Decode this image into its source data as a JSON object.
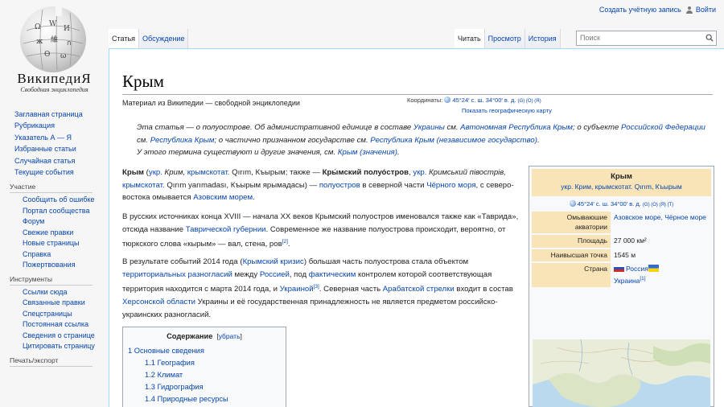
{
  "logo": {
    "title": "ВикипедиЯ",
    "subtitle": "Свободная энциклопедия"
  },
  "personal": {
    "create_account": "Создать учётную запись",
    "login": "Войти"
  },
  "tabs": {
    "left": [
      "Статья",
      "Обсуждение"
    ],
    "right": [
      "Читать",
      "Просмотр",
      "История"
    ]
  },
  "search": {
    "placeholder": "Поиск"
  },
  "sidebar": {
    "main": [
      "Заглавная страница",
      "Рубрикация",
      "Указатель А — Я",
      "Избранные статьи",
      "Случайная статья",
      "Текущие события"
    ],
    "participation": {
      "heading": "Участие",
      "items": [
        "Сообщить об ошибке",
        "Портал сообщества",
        "Форум",
        "Свежие правки",
        "Новые страницы",
        "Справка",
        "Пожертвования"
      ]
    },
    "tools": {
      "heading": "Инструменты",
      "items": [
        "Ссылки сюда",
        "Связанные правки",
        "Спецстраницы",
        "Постоянная ссылка",
        "Сведения о странице",
        "Цитировать страницу"
      ]
    },
    "print": {
      "heading": "Печать/экспорт"
    }
  },
  "article": {
    "title": "Крым",
    "tagline": "Материал из Википедии — свободной энциклопедии",
    "coords_label": "Координаты:",
    "coords": "45°24′ с. ш. 34°00′ в. д.",
    "coords_refs": "(G) (O) (Я)",
    "coords_map": "Показать географическую карту",
    "hatnote": {
      "t1": "Эта статья — о полуострове. Об административной единице в составе ",
      "l1": "Украины",
      "t2": " см. ",
      "l2": "Автономная Республика Крым",
      "t3": "; о субъекте ",
      "l3": "Российской Федерации",
      "t4": " см. ",
      "l4": "Республика Крым",
      "t5": "; о частично признанном государстве см. ",
      "l5": "Республика Крым (независимое государство)",
      "t6": ".",
      "t7": "У этого термина существуют и другие значения, см. ",
      "l6": "Крым (значения)",
      "t8": "."
    },
    "p1": {
      "b1": "Крым",
      "t1": " (",
      "l1": "укр.",
      "t2": " Крим, ",
      "l2": "крымскотат.",
      "t3": " Qırım, Къырым; также — ",
      "b2": "Кры́мский полуо́стров",
      "t4": ", ",
      "l3": "укр.",
      "t5": " Кримський півострів, ",
      "l4": "крымскотат.",
      "t6": " Qırım yarımadası, Къырым ярымадасы) — ",
      "l5": "полуостров",
      "t7": " в северной части ",
      "l6": "Чёрного моря",
      "t8": ", с северо-востока омывается ",
      "l7": "Азовским морем",
      "t9": "."
    },
    "p2": {
      "t1": "В русских источниках конца XVIII — начала XX веков Крымский полуостров именовался также как «Таврида», отсюда название ",
      "l1": "Таврической губернии",
      "t2": ". Современное же название полуострова происходит, вероятно, от тюркского слова «кырым» — вал, стена, ров",
      "ref": "[2]",
      "t3": "."
    },
    "p3": {
      "t1": "В результате событий 2014 года (",
      "l1": "Крымский кризис",
      "t2": ") большая часть полуострова стала объектом ",
      "l2": "территориальных разногласий",
      "t3": " между ",
      "l3": "Россией",
      "t4": ", под ",
      "l4": "фактическим",
      "t5": " контролем которой соответствующая территория находится с марта 2014 года, и ",
      "l5": "Украиной",
      "ref": "[3]",
      "t6": ". Северная часть ",
      "l6": "Арабатской стрелки",
      "t7": " входит в состав ",
      "l7": "Херсонской области",
      "t8": " Украины и её государственная принадлежность не является предметом российско-украинских разногласий."
    }
  },
  "toc": {
    "title": "Содержание",
    "hide": "убрать",
    "items": [
      {
        "num": "1",
        "text": "Основные сведения",
        "level": 1
      },
      {
        "num": "1.1",
        "text": "География",
        "level": 2
      },
      {
        "num": "1.2",
        "text": "Климат",
        "level": 2
      },
      {
        "num": "1.3",
        "text": "Гидрография",
        "level": 2
      },
      {
        "num": "1.4",
        "text": "Природные ресурсы",
        "level": 2
      }
    ]
  },
  "infobox": {
    "title": "Крым",
    "subtitle": "укр. Крим, крымскотат. Qırım, Къырым",
    "coords": "45°24′ с. ш. 34°00′ в. д.",
    "coords_refs": "(G) (O) (Я) (Т)",
    "rows": [
      {
        "label": "Омываюшие акватории",
        "value": "Азовское море, Чёрное море"
      },
      {
        "label": "Площадь",
        "value": "27 000 км²"
      },
      {
        "label": "Наивысшая точка",
        "value": "1545 м"
      },
      {
        "label": "Страна",
        "value_ru": "Россия",
        "value_ua": "Украина",
        "ref": "[1]"
      }
    ]
  }
}
